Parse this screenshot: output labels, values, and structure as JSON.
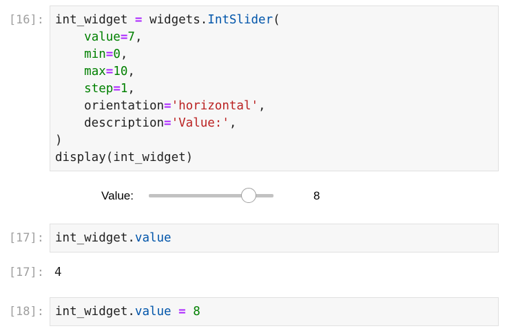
{
  "cells": [
    {
      "prompt": "[16]:",
      "code_lines": [
        [
          {
            "t": "int_widget ",
            "c": ""
          },
          {
            "t": "=",
            "c": "op"
          },
          {
            "t": " widgets.",
            "c": ""
          },
          {
            "t": "IntSlider",
            "c": "attr"
          },
          {
            "t": "(",
            "c": ""
          }
        ],
        [
          {
            "t": "    ",
            "c": ""
          },
          {
            "t": "value",
            "c": "kw"
          },
          {
            "t": "=",
            "c": "op"
          },
          {
            "t": "7",
            "c": "num"
          },
          {
            "t": ",",
            "c": ""
          }
        ],
        [
          {
            "t": "    ",
            "c": ""
          },
          {
            "t": "min",
            "c": "kw"
          },
          {
            "t": "=",
            "c": "op"
          },
          {
            "t": "0",
            "c": "num"
          },
          {
            "t": ",",
            "c": ""
          }
        ],
        [
          {
            "t": "    ",
            "c": ""
          },
          {
            "t": "max",
            "c": "kw"
          },
          {
            "t": "=",
            "c": "op"
          },
          {
            "t": "10",
            "c": "num"
          },
          {
            "t": ",",
            "c": ""
          }
        ],
        [
          {
            "t": "    ",
            "c": ""
          },
          {
            "t": "step",
            "c": "kw"
          },
          {
            "t": "=",
            "c": "op"
          },
          {
            "t": "1",
            "c": "num"
          },
          {
            "t": ",",
            "c": ""
          }
        ],
        [
          {
            "t": "    orientation",
            "c": ""
          },
          {
            "t": "=",
            "c": "op"
          },
          {
            "t": "'horizontal'",
            "c": "str"
          },
          {
            "t": ",",
            "c": ""
          }
        ],
        [
          {
            "t": "    description",
            "c": ""
          },
          {
            "t": "=",
            "c": "op"
          },
          {
            "t": "'Value:'",
            "c": "str"
          },
          {
            "t": ",",
            "c": ""
          }
        ],
        [
          {
            "t": ")",
            "c": ""
          }
        ],
        [
          {
            "t": "display(int_widget)",
            "c": ""
          }
        ]
      ]
    },
    {
      "prompt": "[17]:",
      "code_lines": [
        [
          {
            "t": "int_widget.",
            "c": ""
          },
          {
            "t": "value",
            "c": "attr"
          }
        ]
      ],
      "output_prompt": "[17]:",
      "output": "4"
    },
    {
      "prompt": "[18]:",
      "code_lines": [
        [
          {
            "t": "int_widget.",
            "c": ""
          },
          {
            "t": "value",
            "c": "attr"
          },
          {
            "t": " ",
            "c": ""
          },
          {
            "t": "=",
            "c": "op"
          },
          {
            "t": " ",
            "c": ""
          },
          {
            "t": "8",
            "c": "num"
          }
        ]
      ]
    }
  ],
  "slider_widget": {
    "label": "Value:",
    "readout": "8",
    "value": 8,
    "min": 0,
    "max": 10
  }
}
